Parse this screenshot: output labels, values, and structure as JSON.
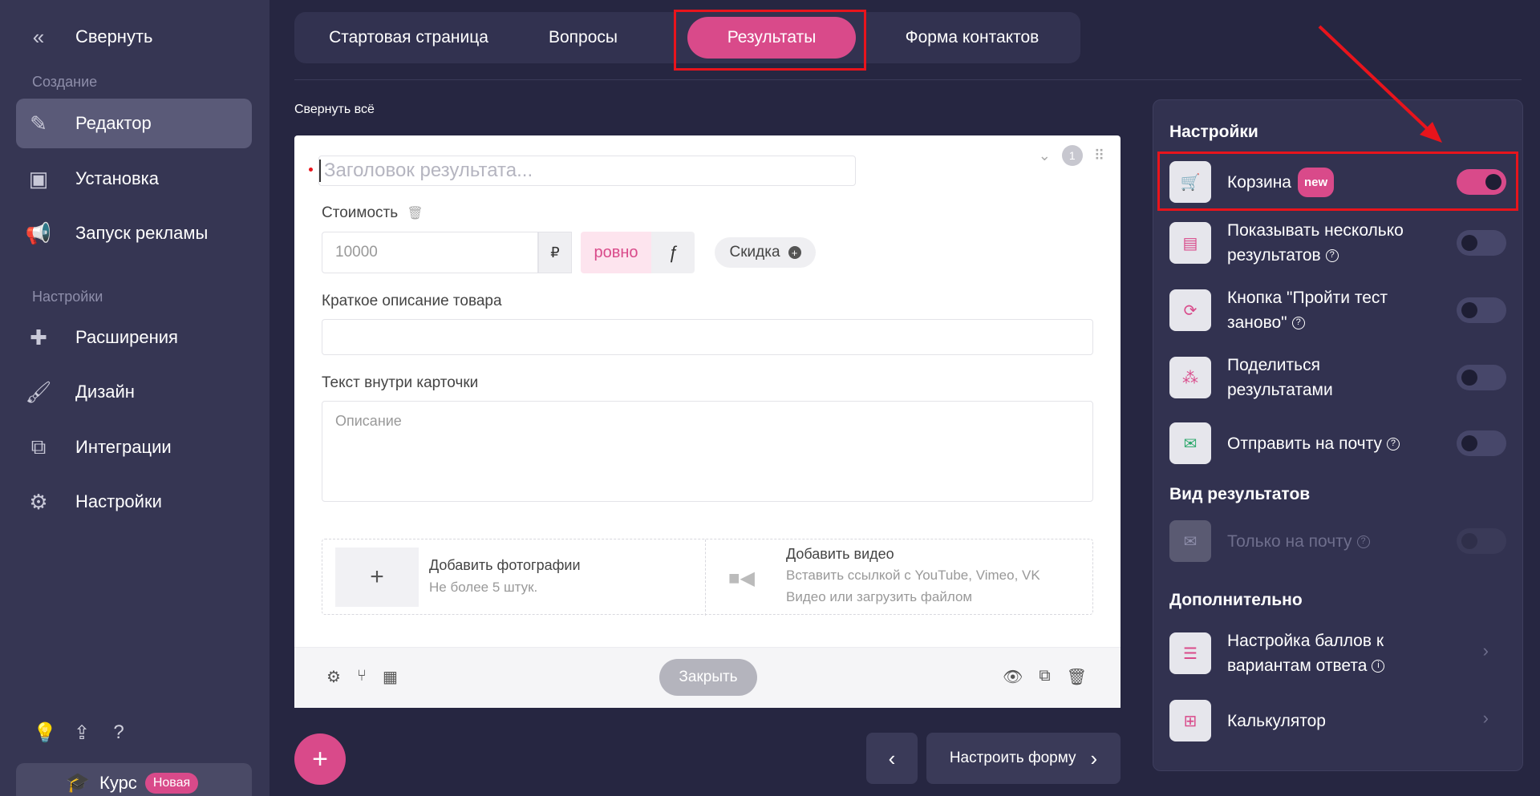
{
  "sidebar": {
    "collapse_label": "Свернуть",
    "section_create": "Создание",
    "section_settings": "Настройки",
    "items_create": [
      {
        "label": "Редактор",
        "icon": "pencil-icon"
      },
      {
        "label": "Установка",
        "icon": "install-icon"
      },
      {
        "label": "Запуск рекламы",
        "icon": "megaphone-icon"
      }
    ],
    "items_settings": [
      {
        "label": "Расширения",
        "icon": "extensions-icon"
      },
      {
        "label": "Дизайн",
        "icon": "brush-icon"
      },
      {
        "label": "Интеграции",
        "icon": "integrations-icon"
      },
      {
        "label": "Настройки",
        "icon": "gear-icon"
      }
    ],
    "course_label": "Курс",
    "course_badge": "Новая"
  },
  "tabs": [
    "Стартовая страница",
    "Вопросы",
    "Результаты",
    "Форма контактов"
  ],
  "active_tab": "Результаты",
  "collapse_all": "Свернуть всё",
  "card": {
    "title_placeholder": "Заголовок результата...",
    "number": "1",
    "price_label": "Стоимость",
    "price_placeholder": "10000",
    "currency": "₽",
    "exact_label": "ровно",
    "formula_label": "ƒ",
    "discount_label": "Скидка",
    "short_desc_label": "Краткое описание товара",
    "inner_text_label": "Текст внутри карточки",
    "inner_text_placeholder": "Описание",
    "photo_title": "Добавить фотографии",
    "photo_sub": "Не более 5 штук.",
    "video_title": "Добавить видео",
    "video_sub1": "Вставить ссылкой с YouTube, Vimeo, VK",
    "video_sub2": "Видео или загрузить файлом",
    "close_label": "Закрыть"
  },
  "nav": {
    "next_label": "Настроить форму"
  },
  "panel": {
    "settings_title": "Настройки",
    "settings": [
      {
        "label": "Корзина",
        "badge": "new",
        "on": true
      },
      {
        "label": "Показывать несколько результатов",
        "on": false
      },
      {
        "label": "Кнопка \"Пройти тест заново\"",
        "on": false
      },
      {
        "label": "Поделиться результатами",
        "on": false
      },
      {
        "label": "Отправить на почту",
        "on": false
      }
    ],
    "view_title": "Вид результатов",
    "view_only_mail": "Только на почту",
    "extra_title": "Дополнительно",
    "extra": [
      {
        "label": "Настройка баллов к вариантам ответа"
      },
      {
        "label": "Калькулятор"
      }
    ]
  },
  "colors": {
    "accent": "#d94a8a",
    "annotation": "#e8141c",
    "background": "#262641"
  }
}
